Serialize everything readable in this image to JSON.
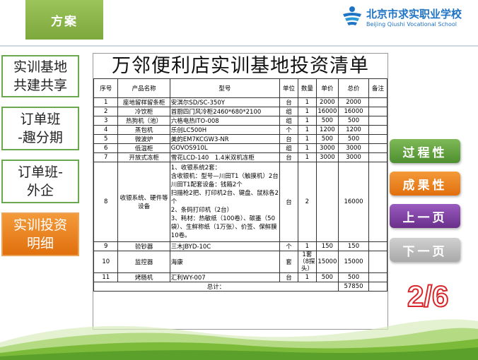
{
  "header": {
    "tab_label": "方案"
  },
  "logo": {
    "name_cn": "北京市求实职业学校",
    "name_en": "Beijing Qiushi Vocational School"
  },
  "sidebar": [
    {
      "label": "实训基地\n共建共享",
      "active": false
    },
    {
      "label": "订单班\n-趣分期",
      "active": false
    },
    {
      "label": "订单班-\n外企",
      "active": false
    },
    {
      "label": "实训投资\n明细",
      "active": true
    }
  ],
  "right_buttons": {
    "process": "过程性",
    "result": "成果性",
    "prev": "上一页",
    "next": "下一页"
  },
  "page_indicator": "2/6",
  "colors": {
    "green": "#6aa84f",
    "orange": "#ea7e1f",
    "purple": "#7b3f98",
    "gray": "#b9b9b9",
    "red": "#d9262b",
    "blue": "#1f73c4"
  },
  "doc": {
    "title": "万邻便利店实训基地投资清单",
    "headers": [
      "序号",
      "产品名称",
      "型号",
      "单位",
      "数量",
      "单价",
      "总价",
      "备注"
    ],
    "rows": [
      [
        "1",
        "座地留样留条柜",
        "安淇尔SD/SC-350Y",
        "台",
        "1",
        "2000",
        "2000",
        ""
      ],
      [
        "2",
        "冷饮柜",
        "首厨四门风冷柜2460*680*2100",
        "组",
        "1",
        "16000",
        "16000",
        ""
      ],
      [
        "3",
        "热狗机（池）",
        "六格电热ITO-008",
        "组",
        "1",
        "500",
        "500",
        ""
      ],
      [
        "4",
        "蒸包机",
        "乐创LC500H",
        "个",
        "1",
        "1200",
        "1200",
        ""
      ],
      [
        "5",
        "微波炉",
        "美的EM7KCGW3-NR",
        "台",
        "1",
        "500",
        "500",
        ""
      ],
      [
        "6",
        "低温柜",
        "GOVOS910L",
        "组",
        "1",
        "3000",
        "3000",
        ""
      ],
      [
        "7",
        "开放式冻柜",
        "雪花LCD-140　1.4米双机冻柜",
        "台",
        "1",
        "3000",
        "3000",
        ""
      ],
      [
        "8",
        "收银系统、硬件等设备",
        "1、收银系统2套：\n含收银机：型号—川田T1（触摸机）2台\n川田T1配套设备：钱箱2个\n扫描枪2把、打印机2台、键盘、鼠标各2个\n2、条码打印机（2台）\n3、耗材：热敏纸（100卷）、碳墨（50袋）、生鲜称纸（1万张）、价签、保鲜膜10卷。",
        "台",
        "2",
        "",
        "16000",
        ""
      ],
      [
        "9",
        "验钞器",
        "三木JBYD-10C",
        "个",
        "1",
        "150",
        "150",
        ""
      ],
      [
        "10",
        "监控器",
        "海康",
        "套",
        "1套（8探头）",
        "15000",
        "15000",
        ""
      ],
      [
        "11",
        "烤肠机",
        "汇利WY-007",
        "台",
        "1",
        "500",
        "500",
        ""
      ]
    ],
    "total_label": "总计：",
    "total_value": "57850"
  }
}
